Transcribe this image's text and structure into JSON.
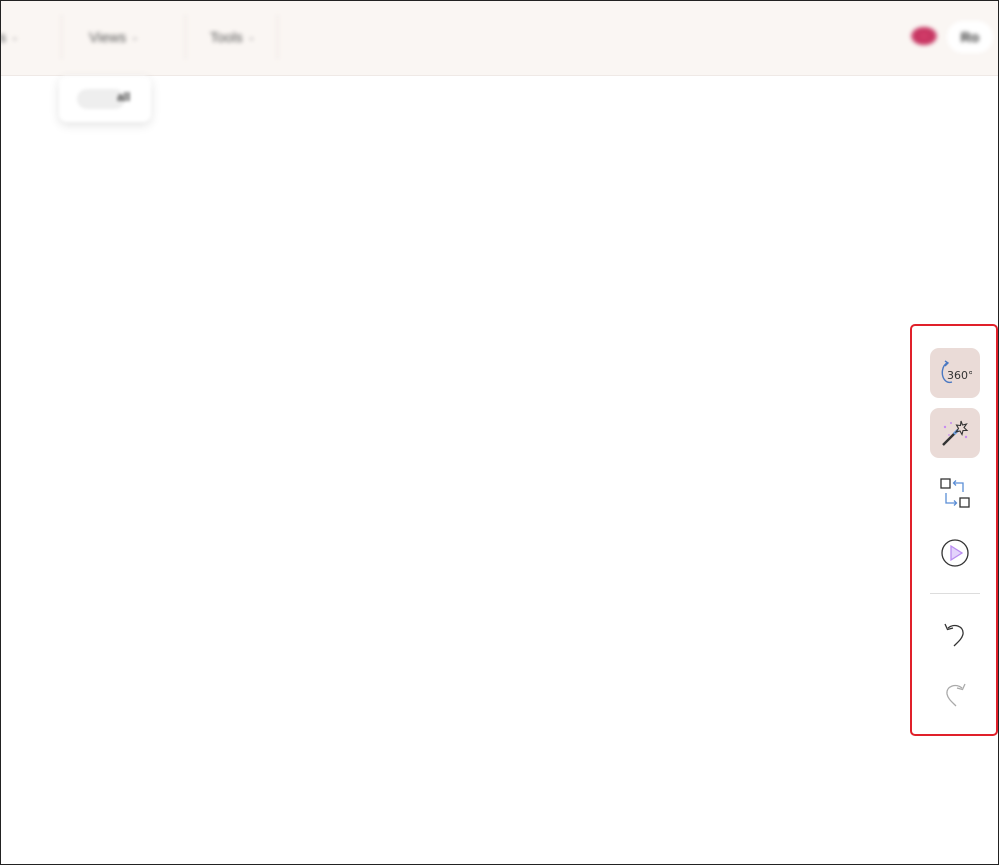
{
  "menubar": {
    "items": [
      {
        "label": "s"
      },
      {
        "label": "Views"
      },
      {
        "label": "Tools"
      }
    ],
    "user_initials": "Ro"
  },
  "pill": {
    "label": "all"
  },
  "toolbar": {
    "tools": [
      {
        "icon": "rotate-360-icon",
        "text": "360°",
        "active": true
      },
      {
        "icon": "magic-wand-icon",
        "active": true
      },
      {
        "icon": "swap-icon",
        "active": false
      },
      {
        "icon": "play-icon",
        "active": false
      },
      {
        "icon": "undo-icon",
        "active": false
      },
      {
        "icon": "redo-icon",
        "active": false,
        "disabled": true
      }
    ]
  },
  "colors": {
    "topbar_bg": "#faf6f3",
    "tool_active_bg": "#eadbd7",
    "highlight_border": "#e0202a",
    "play_accent": "#b98cf0",
    "swap_accent": "#5b8ed6"
  }
}
